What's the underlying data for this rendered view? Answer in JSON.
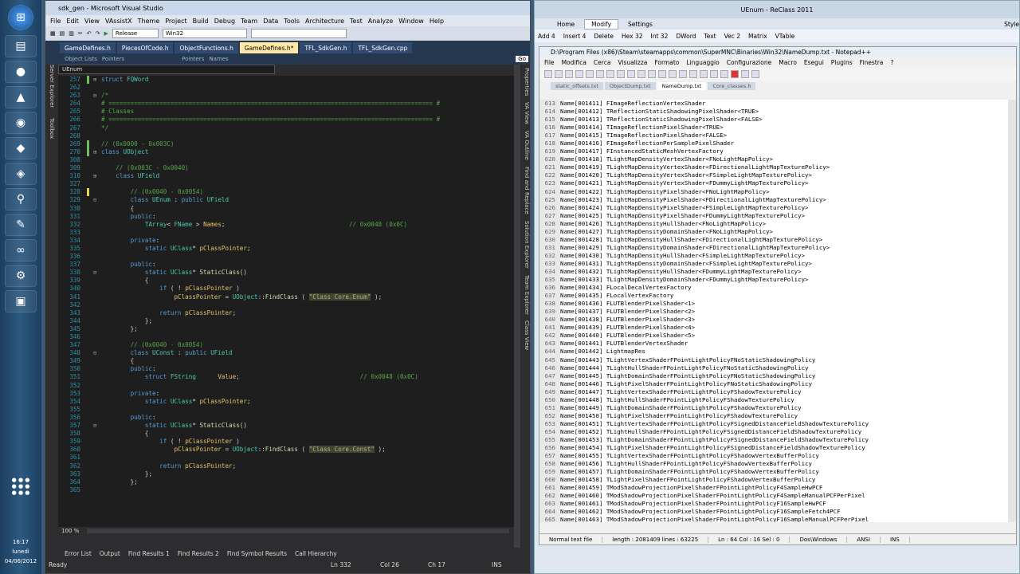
{
  "taskbar": {
    "time": "16:17",
    "day": "lunedì",
    "date": "04/06/2012"
  },
  "vs": {
    "title": "sdk_gen - Microsoft Visual Studio",
    "menu": [
      "File",
      "Edit",
      "View",
      "VAssistX",
      "Theme",
      "Project",
      "Build",
      "Debug",
      "Team",
      "Data",
      "Tools",
      "Architecture",
      "Test",
      "Analyze",
      "Window",
      "Help"
    ],
    "config": "Release",
    "platform": "Win32",
    "tabs": [
      "GameDefines.h",
      "PiecesOfCode.h",
      "ObjectFunctions.h",
      "GameDefines.h*",
      "TFL_SdkGen.h",
      "TFL_SdkGen.cpp"
    ],
    "active_tab": 3,
    "nav_left": "Object Lists",
    "nav_mid1": "Pointers",
    "nav_mid2": "Names",
    "nav_combo": "UEnum",
    "go": "Go",
    "side_right": [
      "Properties",
      "VA View",
      "VA Outline",
      "Find and Replace",
      "Solution Explorer",
      "Team Explorer",
      "Class View"
    ],
    "side_left": [
      "Server Explorer",
      "Toolbox"
    ],
    "zoom": "100 %",
    "bottom_tabs": [
      "Error List",
      "Output",
      "Find Results 1",
      "Find Results 2",
      "Find Symbol Results",
      "Call Hierarchy"
    ],
    "status": {
      "ready": "Ready",
      "ln": "Ln 332",
      "col": "Col 26",
      "ch": "Ch 17",
      "ins": "INS"
    }
  },
  "code": [
    [
      "257",
      "c",
      "+",
      "struct FQWord"
    ],
    [
      "262",
      "",
      "",
      ""
    ],
    [
      "263",
      "",
      "-",
      "/*"
    ],
    [
      "264",
      "",
      "",
      "# ========================================================================================= #"
    ],
    [
      "265",
      "",
      "",
      "# Classes"
    ],
    [
      "266",
      "",
      "",
      "# ========================================================================================= #"
    ],
    [
      "267",
      "",
      "",
      "*/"
    ],
    [
      "268",
      "",
      "",
      ""
    ],
    [
      "269",
      "c",
      "",
      "// (0x0000 - 0x003C)"
    ],
    [
      "270",
      "c",
      "+",
      "class UObject"
    ],
    [
      "308",
      "",
      "",
      ""
    ],
    [
      "309",
      "",
      "",
      "    // (0x003C - 0x0040)"
    ],
    [
      "310",
      "",
      "+",
      "    class UField"
    ],
    [
      "327",
      "",
      "",
      ""
    ],
    [
      "328",
      "y",
      "",
      "        // (0x0040 - 0x0054)"
    ],
    [
      "329",
      "",
      "-",
      "        class UEnum : public UField"
    ],
    [
      "330",
      "",
      "",
      "        {"
    ],
    [
      "331",
      "",
      "",
      "        public:"
    ],
    [
      "332",
      "",
      "",
      "            TArray< FName > Names;                                  // 0x0048 (0x0C)"
    ],
    [
      "333",
      "",
      "",
      ""
    ],
    [
      "334",
      "",
      "",
      "        private:"
    ],
    [
      "335",
      "",
      "",
      "            static UClass* pClassPointer;"
    ],
    [
      "336",
      "",
      "",
      ""
    ],
    [
      "337",
      "",
      "",
      "        public:"
    ],
    [
      "338",
      "",
      "-",
      "            static UClass* StaticClass()"
    ],
    [
      "339",
      "",
      "",
      "            {"
    ],
    [
      "340",
      "",
      "",
      "                if ( ! pClassPointer )"
    ],
    [
      "341",
      "",
      "",
      "                    pClassPointer = UObject::FindClass ( \"Class Core.Enum\" );"
    ],
    [
      "342",
      "",
      "",
      ""
    ],
    [
      "343",
      "",
      "",
      "                return pClassPointer;"
    ],
    [
      "344",
      "",
      "",
      "            };"
    ],
    [
      "345",
      "",
      "",
      "        };"
    ],
    [
      "346",
      "",
      "",
      ""
    ],
    [
      "347",
      "",
      "",
      "        // (0x0040 - 0x0054)"
    ],
    [
      "348",
      "",
      "-",
      "        class UConst : public UField"
    ],
    [
      "349",
      "",
      "",
      "        {"
    ],
    [
      "350",
      "",
      "",
      "        public:"
    ],
    [
      "351",
      "",
      "",
      "            struct FString      Value;                                 // 0x0048 (0x0C)"
    ],
    [
      "352",
      "",
      "",
      ""
    ],
    [
      "353",
      "",
      "",
      "        private:"
    ],
    [
      "354",
      "",
      "",
      "            static UClass* pClassPointer;"
    ],
    [
      "355",
      "",
      "",
      ""
    ],
    [
      "356",
      "",
      "",
      "        public:"
    ],
    [
      "357",
      "",
      "-",
      "            static UClass* StaticClass()"
    ],
    [
      "358",
      "",
      "",
      "            {"
    ],
    [
      "359",
      "",
      "",
      "                if ( ! pClassPointer )"
    ],
    [
      "360",
      "",
      "",
      "                    pClassPointer = UObject::FindClass ( \"Class Core.Const\" );"
    ],
    [
      "361",
      "",
      "",
      ""
    ],
    [
      "362",
      "",
      "",
      "                return pClassPointer;"
    ],
    [
      "363",
      "",
      "",
      "            };"
    ],
    [
      "364",
      "",
      "",
      "        };"
    ],
    [
      "365",
      "",
      "",
      ""
    ]
  ],
  "rc": {
    "title": "UEnum - ReClass 2011",
    "tabs": [
      "Home",
      "Modify",
      "Settings"
    ],
    "style": "Style",
    "ribbon": [
      "Add 4",
      "Insert 4",
      "Delete",
      "Hex 32",
      "Int 32",
      "DWord",
      "Text",
      "Vec 2",
      "Matrix",
      "VTable"
    ]
  },
  "np": {
    "title": "D:\\Program Files (x86)\\Steam\\steamapps\\common\\SuperMNC\\Binaries\\Win32\\NameDump.txt - Notepad++",
    "menu": [
      "File",
      "Modifica",
      "Cerca",
      "Visualizza",
      "Formato",
      "Linguaggio",
      "Configurazione",
      "Macro",
      "Esegui",
      "Plugins",
      "Finestra",
      "?"
    ],
    "tabs": [
      "static_offsets.txt",
      "ObjectDump.txt",
      "NameDump.txt",
      "Core_classes.h"
    ],
    "active_tab": 2,
    "status": [
      "Normal text file",
      "length : 2081409    lines : 63225",
      "Ln : 64    Col : 16    Sel : 0",
      "Dos\\Windows",
      "ANSI",
      "INS"
    ]
  },
  "names": [
    [
      "613",
      "001411",
      "FImageReflectionVertexShader"
    ],
    [
      "614",
      "001412",
      "TReflectionStaticShadowingPixelShader<TRUE>"
    ],
    [
      "615",
      "001413",
      "TReflectionStaticShadowingPixelShader<FALSE>"
    ],
    [
      "616",
      "001414",
      "TImageReflectionPixelShader<TRUE>"
    ],
    [
      "617",
      "001415",
      "TImageReflectionPixelShader<FALSE>"
    ],
    [
      "618",
      "001416",
      "FImageReflectionPerSamplePixelShader"
    ],
    [
      "619",
      "001417",
      "FInstancedStaticMeshVertexFactory"
    ],
    [
      "620",
      "001418",
      "TLightMapDensityVertexShader<FNoLightMapPolicy>"
    ],
    [
      "621",
      "001419",
      "TLightMapDensityVertexShader<FDirectionalLightMapTexturePolicy>"
    ],
    [
      "622",
      "001420",
      "TLightMapDensityVertexShader<FSimpleLightMapTexturePolicy>"
    ],
    [
      "623",
      "001421",
      "TLightMapDensityVertexShader<FDummyLightMapTexturePolicy>"
    ],
    [
      "624",
      "001422",
      "TLightMapDensityPixelShader<FNoLightMapPolicy>"
    ],
    [
      "625",
      "001423",
      "TLightMapDensityPixelShader<FDirectionalLightMapTexturePolicy>"
    ],
    [
      "626",
      "001424",
      "TLightMapDensityPixelShader<FSimpleLightMapTexturePolicy>"
    ],
    [
      "627",
      "001425",
      "TLightMapDensityPixelShader<FDummyLightMapTexturePolicy>"
    ],
    [
      "628",
      "001426",
      "TLightMapDensityHullShader<FNoLightMapPolicy>"
    ],
    [
      "629",
      "001427",
      "TLightMapDensityDomainShader<FNoLightMapPolicy>"
    ],
    [
      "630",
      "001428",
      "TLightMapDensityHullShader<FDirectionalLightMapTexturePolicy>"
    ],
    [
      "631",
      "001429",
      "TLightMapDensityDomainShader<FDirectionalLightMapTexturePolicy>"
    ],
    [
      "632",
      "001430",
      "TLightMapDensityHullShader<FSimpleLightMapTexturePolicy>"
    ],
    [
      "633",
      "001431",
      "TLightMapDensityDomainShader<FSimpleLightMapTexturePolicy>"
    ],
    [
      "634",
      "001432",
      "TLightMapDensityHullShader<FDummyLightMapTexturePolicy>"
    ],
    [
      "635",
      "001433",
      "TLightMapDensityDomainShader<FDummyLightMapTexturePolicy>"
    ],
    [
      "636",
      "001434",
      "FLocalDecalVertexFactory"
    ],
    [
      "637",
      "001435",
      "FLocalVertexFactory"
    ],
    [
      "638",
      "001436",
      "FLUTBlenderPixelShader<1>"
    ],
    [
      "639",
      "001437",
      "FLUTBlenderPixelShader<2>"
    ],
    [
      "640",
      "001438",
      "FLUTBlenderPixelShader<3>"
    ],
    [
      "641",
      "001439",
      "FLUTBlenderPixelShader<4>"
    ],
    [
      "642",
      "001440",
      "FLUTBlenderPixelShader<5>"
    ],
    [
      "643",
      "001441",
      "FLUTBlenderVertexShader"
    ],
    [
      "644",
      "001442",
      "LightmapRes"
    ],
    [
      "645",
      "001443",
      "TLightVertexShaderFPointLightPolicyFNoStaticShadowingPolicy"
    ],
    [
      "646",
      "001444",
      "TLightHullShaderFPointLightPolicyFNoStaticShadowingPolicy"
    ],
    [
      "647",
      "001445",
      "TLightDomainShaderFPointLightPolicyFNoStaticShadowingPolicy"
    ],
    [
      "648",
      "001446",
      "TLightPixelShaderFPointLightPolicyFNoStaticShadowingPolicy"
    ],
    [
      "649",
      "001447",
      "TLightVertexShaderFPointLightPolicyFShadowTexturePolicy"
    ],
    [
      "650",
      "001448",
      "TLightHullShaderFPointLightPolicyFShadowTexturePolicy"
    ],
    [
      "651",
      "001449",
      "TLightDomainShaderFPointLightPolicyFShadowTexturePolicy"
    ],
    [
      "652",
      "001450",
      "TLightPixelShaderFPointLightPolicyFShadowTexturePolicy"
    ],
    [
      "653",
      "001451",
      "TLightVertexShaderFPointLightPolicyFSignedDistanceFieldShadowTexturePolicy"
    ],
    [
      "654",
      "001452",
      "TLightHullShaderFPointLightPolicyFSignedDistanceFieldShadowTexturePolicy"
    ],
    [
      "655",
      "001453",
      "TLightDomainShaderFPointLightPolicyFSignedDistanceFieldShadowTexturePolicy"
    ],
    [
      "656",
      "001454",
      "TLightPixelShaderFPointLightPolicyFSignedDistanceFieldShadowTexturePolicy"
    ],
    [
      "657",
      "001455",
      "TLightVertexShaderFPointLightPolicyFShadowVertexBufferPolicy"
    ],
    [
      "658",
      "001456",
      "TLightHullShaderFPointLightPolicyFShadowVertexBufferPolicy"
    ],
    [
      "659",
      "001457",
      "TLightDomainShaderFPointLightPolicyFShadowVertexBufferPolicy"
    ],
    [
      "660",
      "001458",
      "TLightPixelShaderFPointLightPolicyFShadowVertexBufferPolicy"
    ],
    [
      "661",
      "001459",
      "TModShadowProjectionPixelShaderFPointLightPolicyF4SampleHwPCF"
    ],
    [
      "662",
      "001460",
      "TModShadowProjectionPixelShaderFPointLightPolicyF4SampleManualPCFPerPixel"
    ],
    [
      "663",
      "001461",
      "TModShadowProjectionPixelShaderFPointLightPolicyF16SampleHwPCF"
    ],
    [
      "664",
      "001462",
      "TModShadowProjectionPixelShaderFPointLightPolicyF16SampleFetch4PCF"
    ],
    [
      "665",
      "001463",
      "TModShadowProjectionPixelShaderFPointLightPolicyF16SampleManualPCFPerPixel"
    ]
  ]
}
